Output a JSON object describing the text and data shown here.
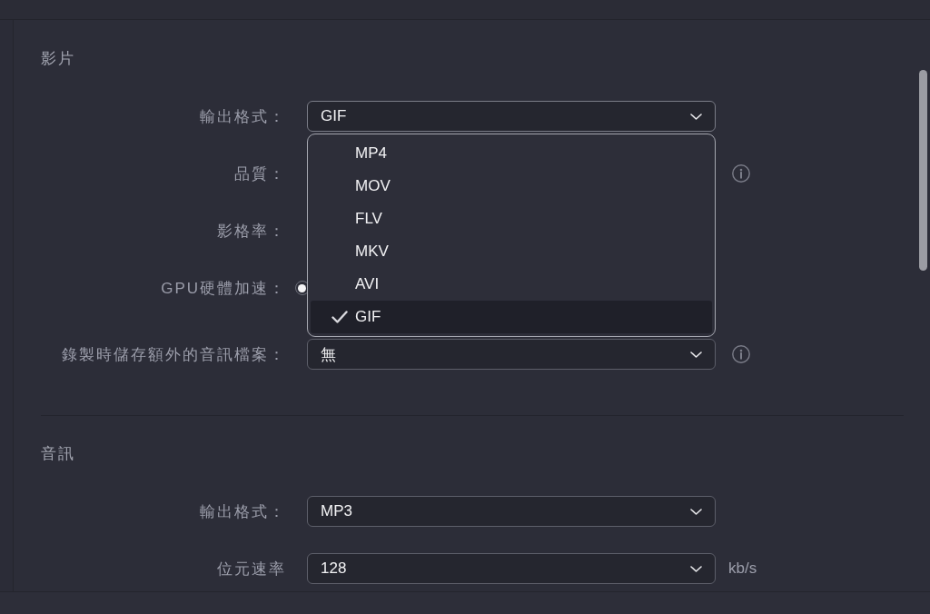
{
  "sections": [
    {
      "title": "影片",
      "rows": [
        {
          "kind": "select",
          "label": "輸出格式：",
          "value": "GIF",
          "expanded": true,
          "info": false,
          "options": [
            {
              "label": "MP4",
              "selected": false
            },
            {
              "label": "MOV",
              "selected": false
            },
            {
              "label": "FLV",
              "selected": false
            },
            {
              "label": "MKV",
              "selected": false
            },
            {
              "label": "AVI",
              "selected": false
            },
            {
              "label": "GIF",
              "selected": true
            }
          ]
        },
        {
          "kind": "covered",
          "label": "品質：",
          "info": true
        },
        {
          "kind": "covered",
          "label": "影格率：",
          "info": false
        },
        {
          "kind": "toggle",
          "label": "GPU硬體加速：",
          "on": false,
          "info": false
        },
        {
          "kind": "select",
          "label": "錄製時儲存額外的音訊檔案：",
          "value": "無",
          "expanded": false,
          "info": true
        }
      ]
    },
    {
      "title": "音訊",
      "rows": [
        {
          "kind": "select",
          "label": "輸出格式：",
          "value": "MP3",
          "expanded": false,
          "info": false
        },
        {
          "kind": "select",
          "label": "位元速率",
          "value": "128",
          "expanded": false,
          "info": false,
          "unit": "kb/s"
        }
      ]
    }
  ]
}
